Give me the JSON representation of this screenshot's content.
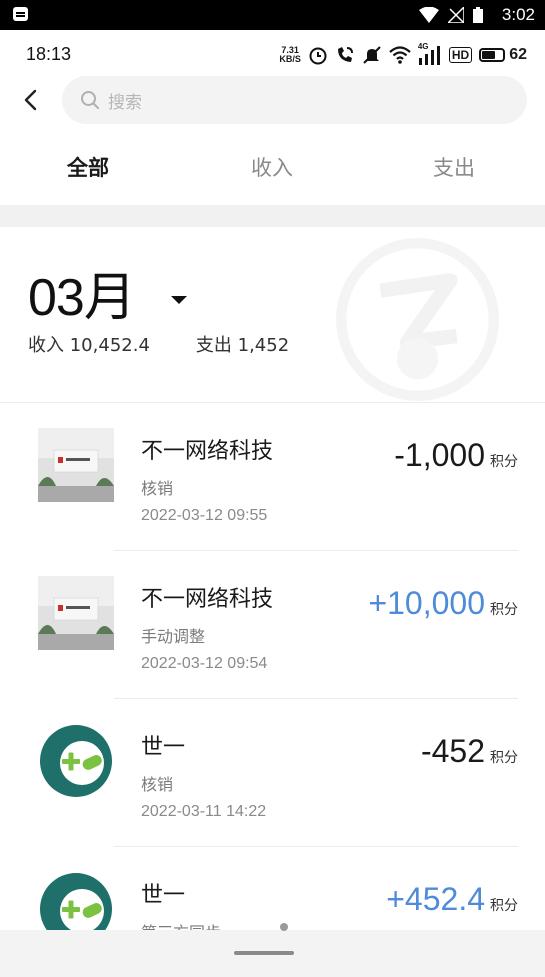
{
  "system_bar": {
    "clock": "3:02"
  },
  "status_bar": {
    "time": "18:13",
    "net_speed_value": "7.31",
    "net_speed_unit": "KB/S",
    "signal_label": "4G",
    "hd_label": "HD",
    "battery_level": "62"
  },
  "search": {
    "placeholder": "搜索"
  },
  "tabs": [
    {
      "label": "全部",
      "active": true
    },
    {
      "label": "收入",
      "active": false
    },
    {
      "label": "支出",
      "active": false
    }
  ],
  "summary": {
    "month": "03月",
    "income_label": "收入",
    "income_value": "10,452.4",
    "expense_label": "支出",
    "expense_value": "1,452"
  },
  "transactions": [
    {
      "name": "不一网络科技",
      "type": "核销",
      "date": "2022-03-12 09:55",
      "amount": "-1,000",
      "unit": "积分",
      "direction": "out",
      "avatar": "office-photo"
    },
    {
      "name": "不一网络科技",
      "type": "手动调整",
      "date": "2022-03-12 09:54",
      "amount": "+10,000",
      "unit": "积分",
      "direction": "in",
      "avatar": "office-photo"
    },
    {
      "name": "世一",
      "type": "核销",
      "date": "2022-03-11 14:22",
      "amount": "-452",
      "unit": "积分",
      "direction": "out",
      "avatar": "green-plus-logo"
    },
    {
      "name": "世一",
      "type": "第三方同步",
      "date": "",
      "amount": "+452.4",
      "unit": "积分",
      "direction": "in",
      "avatar": "green-plus-logo"
    }
  ],
  "colors": {
    "positive": "#4e8bd8",
    "negative": "#1a1a1a",
    "brand_green": "#1f6f6a",
    "plus_green": "#7cc242"
  }
}
